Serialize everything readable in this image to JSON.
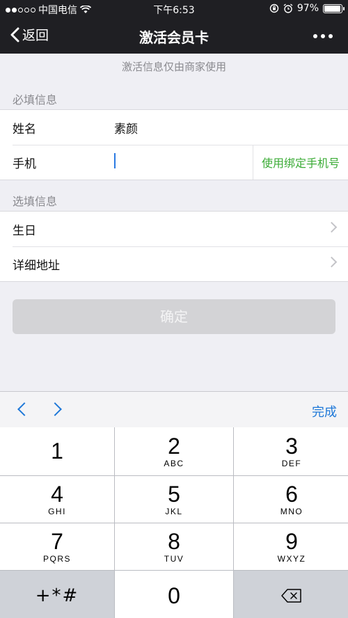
{
  "status": {
    "carrier": "中国电信",
    "time": "下午6:53",
    "battery": "97%",
    "battery_level": 0.97
  },
  "nav": {
    "back_label": "返回",
    "title": "激活会员卡"
  },
  "notice": "激活信息仅由商家使用",
  "required": {
    "label": "必填信息",
    "name_label": "姓名",
    "name_value": "素颜",
    "phone_label": "手机",
    "bind_phone": "使用绑定手机号"
  },
  "optional": {
    "label": "选填信息",
    "birthday_label": "生日",
    "address_label": "详细地址"
  },
  "confirm_label": "确定",
  "accessory": {
    "done_label": "完成"
  },
  "keypad": {
    "k1": {
      "num": "1",
      "letters": ""
    },
    "k2": {
      "num": "2",
      "letters": "ABC"
    },
    "k3": {
      "num": "3",
      "letters": "DEF"
    },
    "k4": {
      "num": "4",
      "letters": "GHI"
    },
    "k5": {
      "num": "5",
      "letters": "JKL"
    },
    "k6": {
      "num": "6",
      "letters": "MNO"
    },
    "k7": {
      "num": "7",
      "letters": "PQRS"
    },
    "k8": {
      "num": "8",
      "letters": "TUV"
    },
    "k9": {
      "num": "9",
      "letters": "WXYZ"
    },
    "symbols": "+*#",
    "k0": {
      "num": "0"
    }
  }
}
